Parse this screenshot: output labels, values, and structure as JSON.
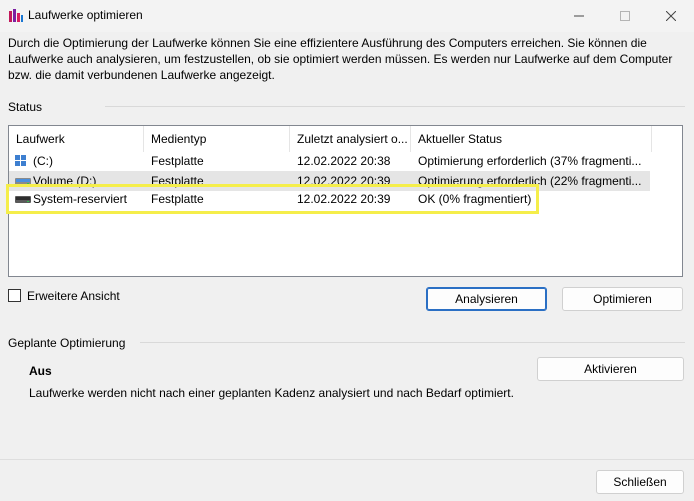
{
  "window": {
    "title": "Laufwerke optimieren",
    "controls": [
      "minimize",
      "maximize",
      "close"
    ]
  },
  "intro_text": "Durch die Optimierung der Laufwerke können Sie eine effizientere Ausführung des Computers erreichen. Sie können die Laufwerke auch analysieren, um festzustellen, ob sie optimiert werden müssen. Es werden nur Laufwerke auf dem Computer bzw. die damit verbundenen Laufwerke angezeigt.",
  "status": {
    "label": "Status",
    "columns": [
      "Laufwerk",
      "Medientyp",
      "Zuletzt analysiert o...",
      "Aktueller Status"
    ],
    "rows": [
      {
        "drive": "(C:)",
        "media": "Festplatte",
        "last": "12.02.2022 20:38",
        "state": "Optimierung erforderlich (37% fragmenti...",
        "icon": "windows-drive-icon"
      },
      {
        "drive": "Volume (D:)",
        "media": "Festplatte",
        "last": "12.02.2022 20:39",
        "state": "Optimierung erforderlich (22% fragmenti...",
        "icon": "hard-drive-icon"
      },
      {
        "drive": "System-reserviert",
        "media": "Festplatte",
        "last": "12.02.2022 20:39",
        "state": "OK (0% fragmentiert)",
        "icon": "hard-drive-icon"
      }
    ],
    "advanced_view_label": "Erweitere Ansicht",
    "analyze_button": "Analysieren",
    "optimize_button": "Optimieren"
  },
  "schedule": {
    "label": "Geplante Optimierung",
    "state": "Aus",
    "description": "Laufwerke werden nicht nach einer geplanten Kadenz analysiert und nach Bedarf optimiert.",
    "activate_button": "Aktivieren"
  },
  "close_button": "Schließen",
  "colors": {
    "highlight": "#f5ee4a",
    "default_button_border": "#2a6fc4",
    "selected_row": "#e5e5e5"
  }
}
